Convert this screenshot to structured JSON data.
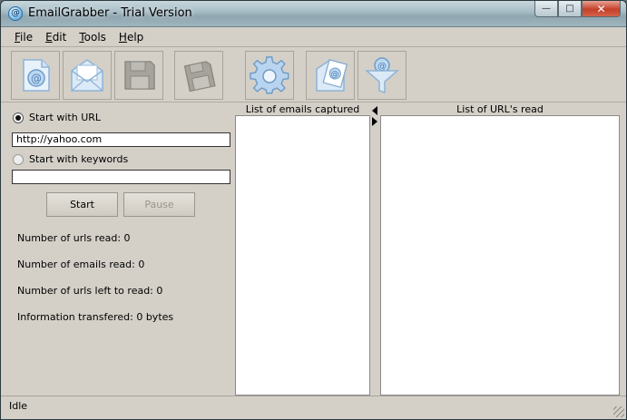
{
  "window": {
    "title": "EmailGrabber - Trial Version",
    "app_icon_glyph": "@"
  },
  "window_controls": {
    "minimize": "—",
    "maximize": "□",
    "close": "✕"
  },
  "menu": {
    "items": [
      {
        "label": "File"
      },
      {
        "label": "Edit"
      },
      {
        "label": "Tools"
      },
      {
        "label": "Help"
      }
    ]
  },
  "toolbar": {
    "buttons": [
      {
        "icon": "email-new-icon"
      },
      {
        "icon": "email-open-icon"
      },
      {
        "icon": "save-disk-icon"
      },
      {
        "icon": "save-as-disk-icon"
      },
      {
        "icon": "settings-gear-icon"
      },
      {
        "icon": "email-document-icon"
      },
      {
        "icon": "email-filter-icon"
      }
    ]
  },
  "search": {
    "url_option_label": "Start with URL",
    "url_value": "http://yahoo.com",
    "keywords_option_label": "Start with keywords",
    "keywords_value": "",
    "selected": "url"
  },
  "actions": {
    "start_label": "Start",
    "pause_label": "Pause"
  },
  "stats": {
    "urls_read_label": "Number of urls read:",
    "urls_read_value": "0",
    "emails_read_label": "Number of emails read:",
    "emails_read_value": "0",
    "urls_left_label": "Number of urls left to read:",
    "urls_left_value": "0",
    "info_transfered_label": "Information transfered:",
    "info_transfered_value": "0 bytes"
  },
  "emails_panel": {
    "header": "List of emails captured",
    "items": []
  },
  "urls_panel": {
    "header": "List of URL's read",
    "items": []
  },
  "status": {
    "text": "Idle"
  }
}
